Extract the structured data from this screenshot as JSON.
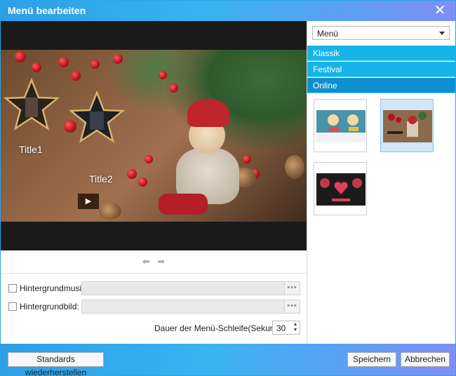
{
  "window": {
    "title": "Menü bearbeiten"
  },
  "preview": {
    "title1": "Title1",
    "title2": "Title2"
  },
  "options": {
    "music_label": "Hintergrundmusik:",
    "image_label": "Hintergrundbild:",
    "browse_label": "•••",
    "loop_label": "Dauer der Menü-Schleife(Sekunde):",
    "loop_value": "30"
  },
  "right_panel": {
    "dropdown_value": "Menü",
    "categories": [
      {
        "label": "Klassik",
        "active": false
      },
      {
        "label": "Festival",
        "active": false
      },
      {
        "label": "Online",
        "active": true
      }
    ]
  },
  "footer": {
    "reset_label": "Standards wiederherstellen",
    "save_label": "Speichern",
    "cancel_label": "Abbrechen"
  },
  "colors": {
    "accent": "#16b3e9",
    "accent_active": "#0f8fcf",
    "selected_thumb": "#cfe6fb"
  }
}
